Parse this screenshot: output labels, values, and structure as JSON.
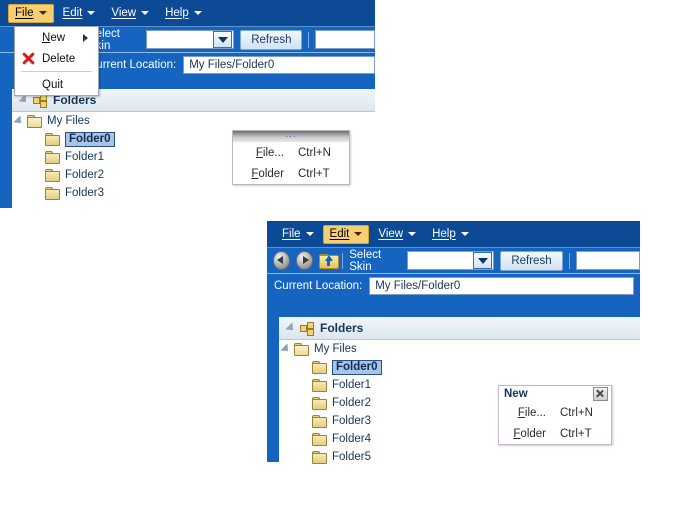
{
  "window1": {
    "menubar": [
      {
        "label": "File",
        "accel": "F",
        "selected": true
      },
      {
        "label": "Edit",
        "accel": "E",
        "selected": false
      },
      {
        "label": "View",
        "accel": "V",
        "selected": false
      },
      {
        "label": "Help",
        "accel": "H",
        "selected": false
      }
    ],
    "toolbar": {
      "select_skin_label": "Select Skin",
      "skin_value": "",
      "refresh_label": "Refresh",
      "search_value": ""
    },
    "location": {
      "caption": "Current Location:",
      "value": "My Files/Folder0"
    },
    "panel": {
      "title": "Folders"
    },
    "tree": [
      {
        "label": "My Files",
        "depth": 0,
        "expanded": true,
        "selected": false
      },
      {
        "label": "Folder0",
        "depth": 1,
        "expanded": false,
        "selected": true
      },
      {
        "label": "Folder1",
        "depth": 1,
        "expanded": false,
        "selected": false
      },
      {
        "label": "Folder2",
        "depth": 1,
        "expanded": false,
        "selected": false
      },
      {
        "label": "Folder3",
        "depth": 1,
        "expanded": false,
        "selected": false
      }
    ],
    "file_menu": {
      "new_label": "New",
      "delete_label": "Delete",
      "quit_label": "Quit",
      "new_icon": "submenu-arrow-icon",
      "delete_icon": "red-x-icon"
    },
    "new_palette": {
      "grip": "···",
      "items": [
        {
          "label": "File...",
          "shortcut": "Ctrl+N"
        },
        {
          "label": "Folder",
          "shortcut": "Ctrl+T"
        }
      ]
    }
  },
  "window2": {
    "menubar": [
      {
        "label": "File",
        "accel": "F",
        "selected": false
      },
      {
        "label": "Edit",
        "accel": "E",
        "selected": true
      },
      {
        "label": "View",
        "accel": "V",
        "selected": false
      },
      {
        "label": "Help",
        "accel": "H",
        "selected": false
      }
    ],
    "toolbar": {
      "back_icon": "back-arrow-icon",
      "forward_icon": "forward-arrow-icon",
      "up_icon": "up-folder-icon",
      "select_skin_label": "Select Skin",
      "skin_value": "",
      "refresh_label": "Refresh",
      "search_value": ""
    },
    "location": {
      "caption": "Current Location:",
      "value": "My Files/Folder0"
    },
    "panel": {
      "title": "Folders"
    },
    "tree": [
      {
        "label": "My Files",
        "depth": 0,
        "expanded": true,
        "selected": false
      },
      {
        "label": "Folder0",
        "depth": 1,
        "expanded": false,
        "selected": true
      },
      {
        "label": "Folder1",
        "depth": 1,
        "expanded": false,
        "selected": false
      },
      {
        "label": "Folder2",
        "depth": 1,
        "expanded": false,
        "selected": false
      },
      {
        "label": "Folder3",
        "depth": 1,
        "expanded": false,
        "selected": false
      },
      {
        "label": "Folder4",
        "depth": 1,
        "expanded": false,
        "selected": false
      },
      {
        "label": "Folder5",
        "depth": 1,
        "expanded": false,
        "selected": false
      }
    ],
    "new_palette": {
      "title": "New",
      "close_icon": "close-icon",
      "items": [
        {
          "label": "File...",
          "shortcut": "Ctrl+N"
        },
        {
          "label": "Folder",
          "shortcut": "Ctrl+T"
        }
      ]
    }
  },
  "colors": {
    "menubar": "#0c4a96",
    "toolbar": "#1565c0",
    "accent_selected_menu": "#f8cf70",
    "tree_text": "#14365c",
    "selection": "#a8c4e4",
    "delete_icon": "#d31f1f"
  }
}
